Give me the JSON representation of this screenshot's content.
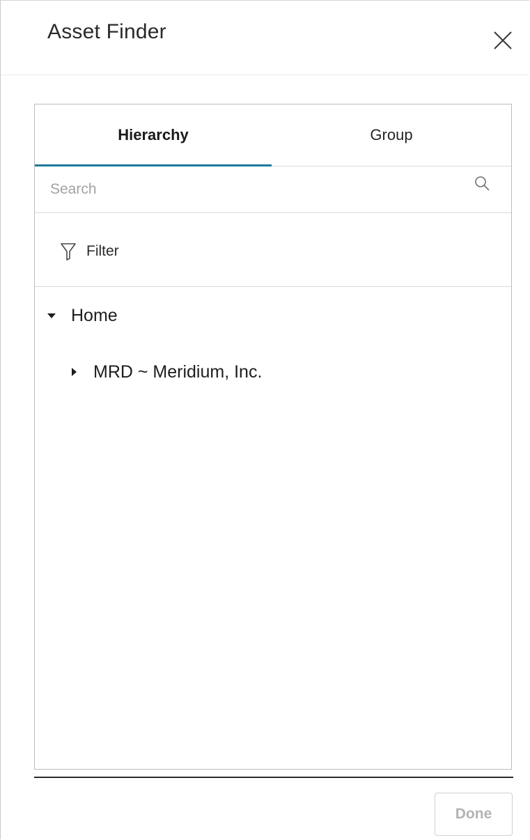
{
  "dialog": {
    "title": "Asset Finder",
    "close_icon": "close-icon"
  },
  "tabs": [
    {
      "label": "Hierarchy",
      "active": true
    },
    {
      "label": "Group",
      "active": false
    }
  ],
  "search": {
    "placeholder": "Search",
    "value": "",
    "icon": "search-icon"
  },
  "filter": {
    "label": "Filter",
    "icon": "filter-icon"
  },
  "tree": [
    {
      "label": "Home",
      "expanded": true,
      "icon": "caret-down-icon"
    },
    {
      "label": "MRD ~ Meridium, Inc.",
      "expanded": false,
      "icon": "caret-right-icon"
    }
  ],
  "footer": {
    "done_label": "Done",
    "done_enabled": false
  },
  "colors": {
    "accent": "#1b7a9c",
    "border": "#bdbdbd",
    "disabled_text": "#b3b3b3"
  }
}
